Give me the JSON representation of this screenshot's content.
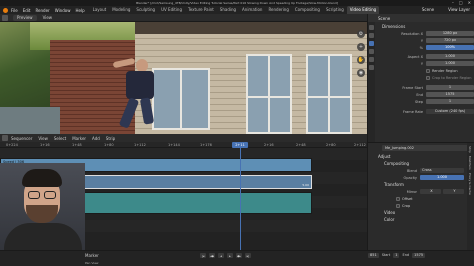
{
  "window": {
    "title": "Blender* [/mnt/Samsung_4TB/Unity/Video Editing Tutorial Series/Part 016 Slowing Down And Speeding Up Footage/Slow-Motion.blend]",
    "controls": [
      "–",
      "□",
      "✕"
    ]
  },
  "menubar": {
    "menus": [
      "File",
      "Edit",
      "Render",
      "Window",
      "Help"
    ],
    "workspaces": [
      "Layout",
      "Modeling",
      "Sculpting",
      "UV Editing",
      "Texture Paint",
      "Shading",
      "Animation",
      "Rendering",
      "Compositing",
      "Scripting",
      "Video Editing"
    ],
    "active_workspace": "Video Editing",
    "scene_label": "Scene",
    "view_layer_label": "View Layer"
  },
  "preview_header": {
    "mode": "Preview",
    "view": "View"
  },
  "sequencer_header": {
    "mode": "Sequencer",
    "menus": [
      "View",
      "Select",
      "Marker",
      "Add",
      "Strip"
    ]
  },
  "ruler": {
    "ticks": [
      "0+224",
      "1+16",
      "1+48",
      "1+80",
      "1+112",
      "1+144",
      "1+176",
      "2+16",
      "2+48",
      "2+80",
      "2+112"
    ],
    "current": "2+11"
  },
  "strips": {
    "speed_label": "Speed | 306",
    "movie_label": "Me_Jumping.mp4 | 116",
    "movie_end": "5.00"
  },
  "properties": {
    "scene": "Scene",
    "section_dimensions": "Dimensions",
    "resolution_x_label": "Resolution X",
    "resolution_x": "1280 px",
    "resolution_y_label": "Y",
    "resolution_y": "720 px",
    "percent_label": "%",
    "percent": "100%",
    "aspect_x_label": "Aspect X",
    "aspect_x": "1.000",
    "aspect_y_label": "Y",
    "aspect_y": "1.000",
    "render_region": "Render Region",
    "crop_region": "Crop to Render Region",
    "frame_start_label": "Frame Start",
    "frame_start": "1",
    "end_label": "End",
    "end": "1575",
    "step_label": "Step",
    "step": "1",
    "frame_rate_label": "Frame Rate",
    "frame_rate": "Custom (240 fps)"
  },
  "strip_props": {
    "name": "Me_Jumping.002",
    "section_adjust": "Adjust",
    "section_compositing": "Compositing",
    "blend_label": "Blend",
    "blend": "Cross",
    "opacity_label": "Opacity",
    "opacity": "1.000",
    "section_transform": "Transform",
    "mirror_label": "Mirror",
    "mirror_x": "X",
    "mirror_y": "Y",
    "offset": "Offset",
    "crop": "Crop",
    "section_video": "Video",
    "section_color": "Color",
    "vtabs": [
      "Strip",
      "Modifiers",
      "Proxy & Cache"
    ]
  },
  "bottombar": {
    "marker": "Marker",
    "status": "Pan View",
    "frame": "851",
    "start_label": "Start",
    "start": "1",
    "end_label": "End",
    "end": "1575"
  }
}
